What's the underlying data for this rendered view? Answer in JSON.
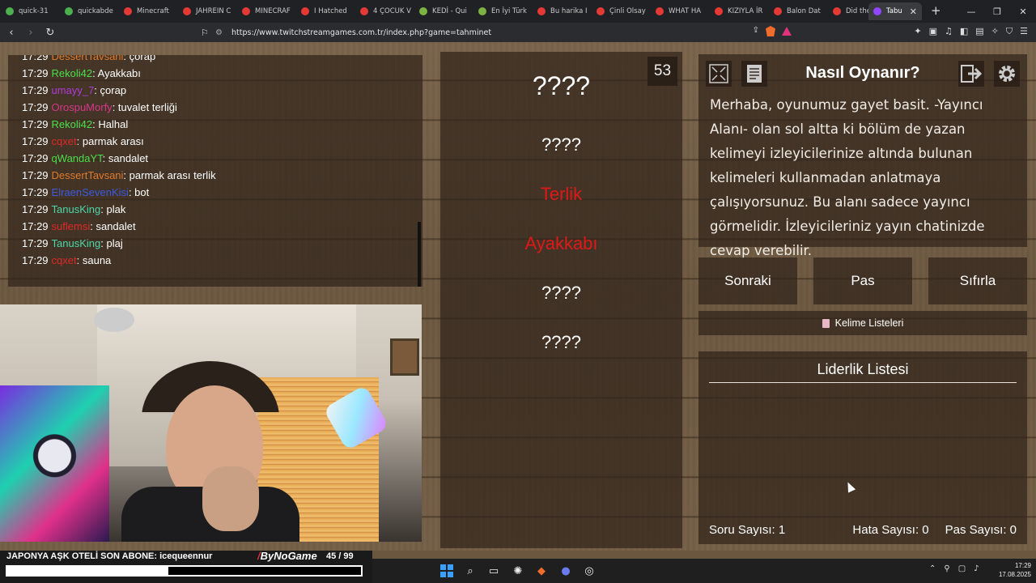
{
  "browser": {
    "tabs": [
      {
        "label": "quick-31",
        "color": "#4caf50"
      },
      {
        "label": "quickabde",
        "color": "#4caf50"
      },
      {
        "label": "Minecraft",
        "color": "#e53935"
      },
      {
        "label": "JAHREIN C",
        "color": "#e53935"
      },
      {
        "label": "MINECRAF",
        "color": "#e53935"
      },
      {
        "label": "I Hatched",
        "color": "#e53935"
      },
      {
        "label": "4 ÇOCUK V",
        "color": "#e53935"
      },
      {
        "label": "KEDİ - Qui",
        "color": "#7cb342"
      },
      {
        "label": "En İyi Türk",
        "color": "#7cb342"
      },
      {
        "label": "Bu harika I",
        "color": "#e53935"
      },
      {
        "label": "Çinli Olsay",
        "color": "#e53935"
      },
      {
        "label": "WHAT HA",
        "color": "#e53935"
      },
      {
        "label": "KIZIYLA İR",
        "color": "#e53935"
      },
      {
        "label": "Balon Dat",
        "color": "#e53935"
      },
      {
        "label": "Did the Ur",
        "color": "#e53935"
      }
    ],
    "active_tab": "Tabu",
    "url": "https://www.twitchstreamgames.com.tr/index.php?game=tahminet"
  },
  "chat": [
    {
      "time": "17:29",
      "user": "DessertTavsani",
      "color": "#e07a2a",
      "msg": "çorap"
    },
    {
      "time": "17:29",
      "user": "Rekoli42",
      "color": "#49e04a",
      "msg": "Ayakkabı"
    },
    {
      "time": "17:29",
      "user": "umayy_7",
      "color": "#b03ad8",
      "msg": "çorap"
    },
    {
      "time": "17:29",
      "user": "OrospuMorfy",
      "color": "#d8368a",
      "msg": "tuvalet terliği"
    },
    {
      "time": "17:29",
      "user": "Rekoli42",
      "color": "#49e04a",
      "msg": "Halhal"
    },
    {
      "time": "17:29",
      "user": "cqxet",
      "color": "#e02828",
      "msg": "parmak arası"
    },
    {
      "time": "17:29",
      "user": "qWandaYT",
      "color": "#49e04a",
      "msg": "sandalet"
    },
    {
      "time": "17:29",
      "user": "DessertTavsani",
      "color": "#e07a2a",
      "msg": "parmak arası terlik"
    },
    {
      "time": "17:29",
      "user": "ElraenSevenKisi",
      "color": "#3a5ae0",
      "msg": "bot"
    },
    {
      "time": "17:29",
      "user": "TanusKing",
      "color": "#4ad8a8",
      "msg": "plak"
    },
    {
      "time": "17:29",
      "user": "suflemsi",
      "color": "#e02828",
      "msg": "sandalet"
    },
    {
      "time": "17:29",
      "user": "TanusKing",
      "color": "#4ad8a8",
      "msg": "plaj"
    },
    {
      "time": "17:29",
      "user": "cqxet",
      "color": "#e02828",
      "msg": "sauna"
    }
  ],
  "game": {
    "counter": "53",
    "words": [
      {
        "text": "????",
        "red": false,
        "size": 32
      },
      {
        "text": "????",
        "red": false,
        "size": 22
      },
      {
        "text": "Terlik",
        "red": true,
        "size": 22
      },
      {
        "text": "Ayakkabı",
        "red": true,
        "size": 22
      },
      {
        "text": "????",
        "red": false,
        "size": 22
      },
      {
        "text": "????",
        "red": false,
        "size": 22
      }
    ]
  },
  "howto": {
    "title": "Nasıl Oynanır?",
    "text": "Merhaba, oyunumuz gayet basit. -Yayıncı Alanı- olan sol altta ki bölüm de yazan kelimeyi izleyicilerinize altında bulunan kelimeleri kullanmadan anlatmaya çalışıyorsunuz. Bu alanı sadece yayıncı görmelidir. İzleyicileriniz yayın chatinizde cevap verebilir.",
    "icons": [
      "fullscreen-icon",
      "document-icon",
      "exit-icon",
      "gear-icon"
    ]
  },
  "buttons": {
    "next": "Sonraki",
    "pass": "Pas",
    "reset": "Sıfırla"
  },
  "word_lists": "Kelime Listeleri",
  "leaderboard": {
    "title": "Liderlik Listesi",
    "questions": "Soru Sayısı: 1",
    "errors": "Hata Sayısı: 0",
    "passes": "Pas Sayısı: 0"
  },
  "stream": {
    "overlay_text": "JAPONYA AŞK OTELİ  SON ABONE: icequeennur",
    "logo": "ByNoGame",
    "count": "45  / 99",
    "progress": 0.4545
  },
  "taskbar": {
    "time": "17:29",
    "date": "17.08.2025"
  }
}
